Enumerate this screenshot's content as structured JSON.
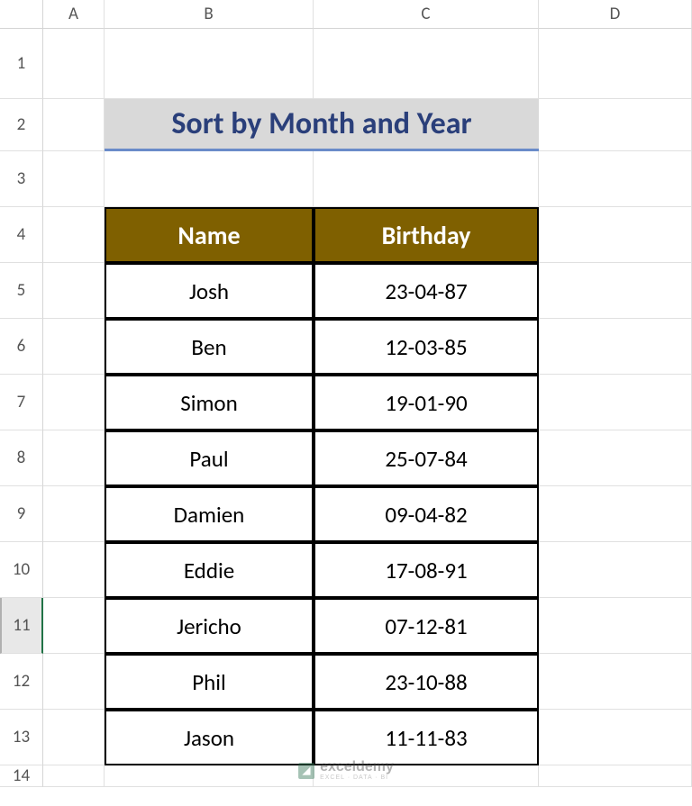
{
  "columns": [
    "",
    "A",
    "B",
    "C",
    "D"
  ],
  "rows": [
    "1",
    "2",
    "3",
    "4",
    "5",
    "6",
    "7",
    "8",
    "9",
    "10",
    "11",
    "12",
    "13",
    "14"
  ],
  "title": "Sort by Month and Year",
  "headers": {
    "name": "Name",
    "birthday": "Birthday"
  },
  "data": [
    {
      "name": "Josh",
      "birthday": "23-04-87"
    },
    {
      "name": "Ben",
      "birthday": "12-03-85"
    },
    {
      "name": "Simon",
      "birthday": "19-01-90"
    },
    {
      "name": "Paul",
      "birthday": "25-07-84"
    },
    {
      "name": "Damien",
      "birthday": "09-04-82"
    },
    {
      "name": "Eddie",
      "birthday": "17-08-91"
    },
    {
      "name": "Jericho",
      "birthday": "07-12-81"
    },
    {
      "name": "Phil",
      "birthday": "23-10-88"
    },
    {
      "name": "Jason",
      "birthday": "11-11-83"
    }
  ],
  "watermark": {
    "name": "exceldemy",
    "tagline": "EXCEL · DATA · BI"
  },
  "selected_row": "11"
}
